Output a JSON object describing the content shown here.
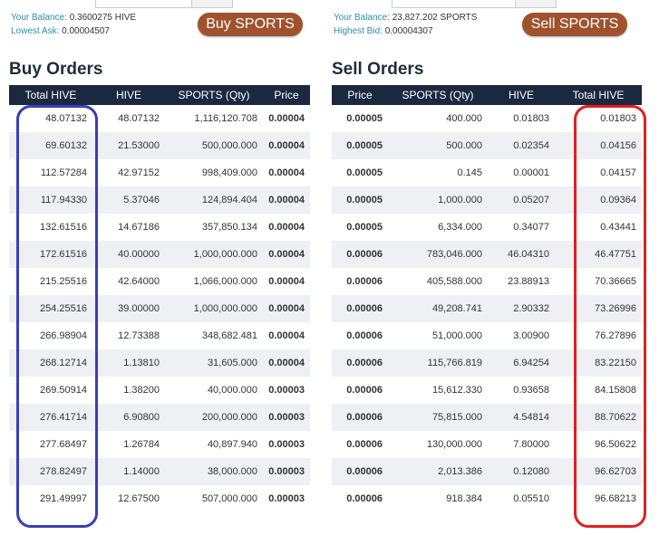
{
  "buy": {
    "balance_label": "Your Balance:",
    "balance_value": "0.3600275 HIVE",
    "ask_label": "Lowest Ask:",
    "ask_value": "0.00004507",
    "button": "Buy SPORTS",
    "title": "Buy Orders",
    "headers": [
      "Total HIVE",
      "HIVE",
      "SPORTS (Qty)",
      "Price"
    ],
    "rows": [
      [
        "48.07132",
        "48.07132",
        "1,116,120.708",
        "0.00004"
      ],
      [
        "69.60132",
        "21.53000",
        "500,000.000",
        "0.00004"
      ],
      [
        "112.57284",
        "42.97152",
        "998,409.000",
        "0.00004"
      ],
      [
        "117.94330",
        "5.37046",
        "124,894.404",
        "0.00004"
      ],
      [
        "132.61516",
        "14.67186",
        "357,850.134",
        "0.00004"
      ],
      [
        "172.61516",
        "40.00000",
        "1,000,000.000",
        "0.00004"
      ],
      [
        "215.25516",
        "42.64000",
        "1,066,000.000",
        "0.00004"
      ],
      [
        "254.25516",
        "39.00000",
        "1,000,000.000",
        "0.00004"
      ],
      [
        "266.98904",
        "12.73388",
        "348,682.481",
        "0.00004"
      ],
      [
        "268.12714",
        "1.13810",
        "31,605.000",
        "0.00004"
      ],
      [
        "269.50914",
        "1.38200",
        "40,000.000",
        "0.00003"
      ],
      [
        "276.41714",
        "6.90800",
        "200,000.000",
        "0.00003"
      ],
      [
        "277.68497",
        "1.26784",
        "40,897.940",
        "0.00003"
      ],
      [
        "278.82497",
        "1.14000",
        "38,000.000",
        "0.00003"
      ],
      [
        "291.49997",
        "12.67500",
        "507,000.000",
        "0.00003"
      ]
    ]
  },
  "sell": {
    "balance_label": "Your Balance:",
    "balance_value": "23,827.202 SPORTS",
    "bid_label": "Highest Bid:",
    "bid_value": "0.00004307",
    "button": "Sell SPORTS",
    "title": "Sell Orders",
    "headers": [
      "Price",
      "SPORTS (Qty)",
      "HIVE",
      "Total HIVE"
    ],
    "rows": [
      [
        "0.00005",
        "400.000",
        "0.01803",
        "0.01803"
      ],
      [
        "0.00005",
        "500.000",
        "0.02354",
        "0.04156"
      ],
      [
        "0.00005",
        "0.145",
        "0.00001",
        "0.04157"
      ],
      [
        "0.00005",
        "1,000.000",
        "0.05207",
        "0.09364"
      ],
      [
        "0.00005",
        "6,334.000",
        "0.34077",
        "0.43441"
      ],
      [
        "0.00006",
        "783,046.000",
        "46.04310",
        "46.47751"
      ],
      [
        "0.00006",
        "405,588.000",
        "23.88913",
        "70.36665"
      ],
      [
        "0.00006",
        "49,208.741",
        "2.90332",
        "73.26996"
      ],
      [
        "0.00006",
        "51,000.000",
        "3.00900",
        "76.27896"
      ],
      [
        "0.00006",
        "115,766.819",
        "6.94254",
        "83.22150"
      ],
      [
        "0.00006",
        "15,612.330",
        "0.93658",
        "84.15808"
      ],
      [
        "0.00006",
        "75,815.000",
        "4.54814",
        "88.70622"
      ],
      [
        "0.00006",
        "130,000.000",
        "7.80000",
        "96.50622"
      ],
      [
        "0.00006",
        "2,013.386",
        "0.12080",
        "96.62703"
      ],
      [
        "0.00006",
        "918.384",
        "0.05510",
        "96.68213"
      ]
    ]
  },
  "colors": {
    "buy_highlight": "#3a3fb5",
    "sell_highlight": "#e02020",
    "button": "#a0522d",
    "header": "#1a2940"
  }
}
